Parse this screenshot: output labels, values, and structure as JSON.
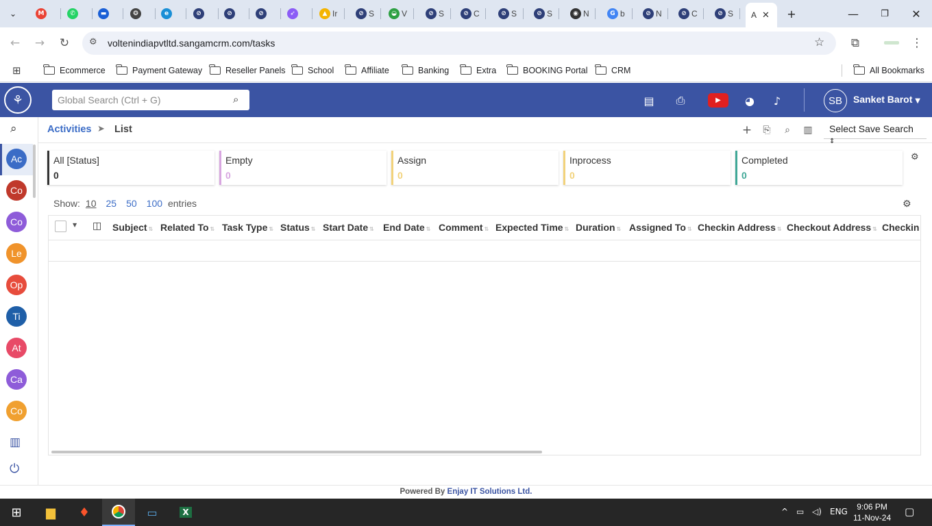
{
  "browser": {
    "url": "voltenindiapvtltd.sangamcrm.com/tasks",
    "active_tab_letter": "A",
    "tabs": [
      {
        "icon": "gmail-icon",
        "color": "#ea4335",
        "text": "M"
      },
      {
        "icon": "whatsapp-icon",
        "color": "#25d366",
        "text": "✆"
      },
      {
        "icon": "chat-icon",
        "color": "#1a5fd6",
        "text": "▬"
      },
      {
        "icon": "openai-icon",
        "color": "#444",
        "text": "❂"
      },
      {
        "icon": "edge-like-icon",
        "color": "#1a8fd6",
        "text": "e"
      },
      {
        "icon": "sangam-icon",
        "color": "#2e3f78",
        "text": "⊘"
      },
      {
        "icon": "sangam-icon",
        "color": "#2e3f78",
        "text": "⊘"
      },
      {
        "icon": "sangam-icon",
        "color": "#2e3f78",
        "text": "⊘"
      },
      {
        "icon": "rocket-icon",
        "color": "#8b5cf6",
        "text": "➶"
      },
      {
        "icon": "google-drive-icon",
        "color": "#f4b400",
        "text": "▲",
        "label": "Ir"
      },
      {
        "icon": "sangam-icon",
        "color": "#2e3f78",
        "text": "⊘",
        "label": "S"
      },
      {
        "icon": "android-icon",
        "color": "#2ea043",
        "text": "◒",
        "label": "V"
      },
      {
        "icon": "sangam-icon",
        "color": "#2e3f78",
        "text": "⊘",
        "label": "S"
      },
      {
        "icon": "sangam-icon",
        "color": "#2e3f78",
        "text": "⊘",
        "label": "C"
      },
      {
        "icon": "sangam-icon",
        "color": "#2e3f78",
        "text": "⊘",
        "label": "S"
      },
      {
        "icon": "sangam-icon",
        "color": "#2e3f78",
        "text": "⊘",
        "label": "S"
      },
      {
        "icon": "github-icon",
        "color": "#333",
        "text": "◉",
        "label": "N"
      },
      {
        "icon": "google-icon",
        "color": "#4285f4",
        "text": "G",
        "label": "b"
      },
      {
        "icon": "sangam-icon",
        "color": "#2e3f78",
        "text": "⊘",
        "label": "N"
      },
      {
        "icon": "sangam-icon",
        "color": "#2e3f78",
        "text": "⊘",
        "label": "C"
      },
      {
        "icon": "sangam-icon",
        "color": "#2e3f78",
        "text": "⊘",
        "label": "S"
      }
    ],
    "bookmarks": [
      "Ecommerce",
      "Payment Gateway",
      "Reseller Panels",
      "School",
      "Affiliate",
      "Banking",
      "Extra",
      "BOOKING Portal",
      "CRM"
    ],
    "all_bookmarks": "All Bookmarks"
  },
  "header": {
    "search_placeholder": "Global Search (Ctrl + G)",
    "user_initials": "SB",
    "user_name": "Sanket Barot"
  },
  "rail": {
    "modules": [
      {
        "label": "Ac",
        "color": "#3b6cc6"
      },
      {
        "label": "Co",
        "color": "#c0392b"
      },
      {
        "label": "Co",
        "color": "#8e5cd9"
      },
      {
        "label": "Le",
        "color": "#f0932b"
      },
      {
        "label": "Op",
        "color": "#e74c3c"
      },
      {
        "label": "Ti",
        "color": "#1f5fa8"
      },
      {
        "label": "At",
        "color": "#e84a67"
      },
      {
        "label": "Ca",
        "color": "#8e5cd9"
      },
      {
        "label": "Co",
        "color": "#f0a030"
      }
    ]
  },
  "page": {
    "breadcrumb_module": "Activities",
    "breadcrumb_view": "List",
    "save_search": "Select Save Search"
  },
  "status_cards": [
    {
      "label": "All [Status]",
      "value": "0",
      "color": "#333333"
    },
    {
      "label": "Empty",
      "value": "0",
      "color": "#d8a6e0"
    },
    {
      "label": "Assign",
      "value": "0",
      "color": "#f2d27a"
    },
    {
      "label": "Inprocess",
      "value": "0",
      "color": "#f2d27a"
    },
    {
      "label": "Completed",
      "value": "0",
      "color": "#3fa796"
    }
  ],
  "entries": {
    "show_label": "Show:",
    "options": [
      "10",
      "25",
      "50",
      "100"
    ],
    "selected": "10",
    "suffix": "entries"
  },
  "table": {
    "columns": [
      "Subject",
      "Related To",
      "Task Type",
      "Status",
      "Start Date",
      "End Date",
      "Comment",
      "Expected Time",
      "Duration",
      "Assigned To",
      "Checkin Address",
      "Checkout Address",
      "Checkin I"
    ]
  },
  "footer": {
    "prefix": "Powered By ",
    "company": "Enjay IT Solutions Ltd."
  },
  "taskbar": {
    "lang": "ENG",
    "time": "9:06 PM",
    "date": "11-Nov-24"
  }
}
